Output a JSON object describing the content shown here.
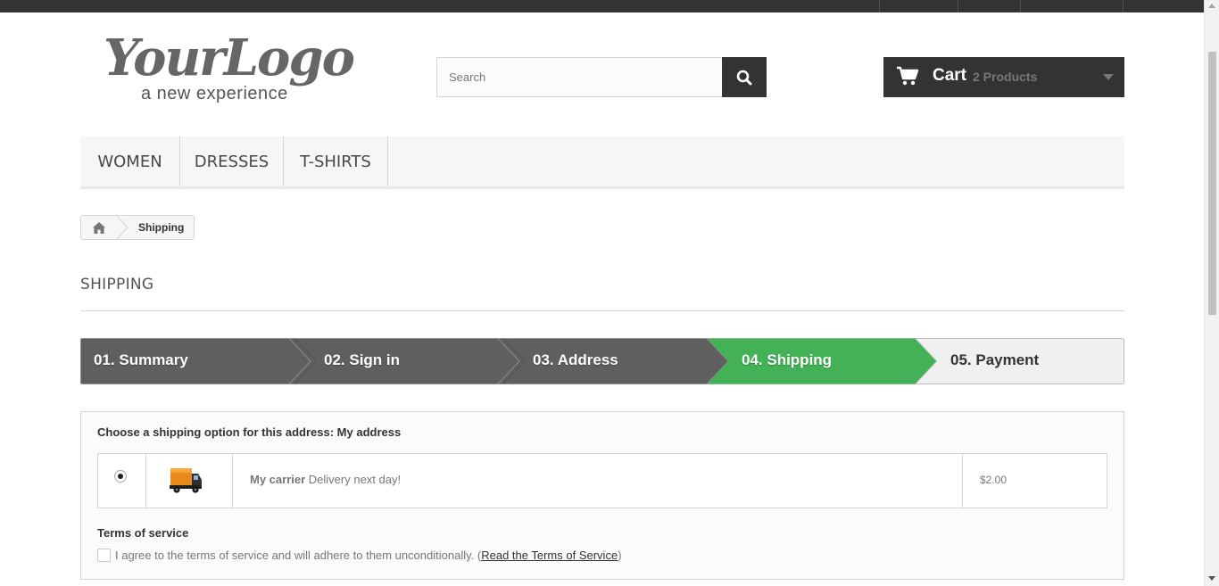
{
  "header": {
    "logo": {
      "main": "YourLogo",
      "tagline": "a new experience"
    },
    "search": {
      "placeholder": "Search"
    },
    "cart": {
      "title": "Cart",
      "quantity": "2 Products"
    }
  },
  "menu": {
    "items": [
      {
        "label": "Women"
      },
      {
        "label": "Dresses"
      },
      {
        "label": "T-shirts"
      }
    ]
  },
  "breadcrumb": {
    "current": "Shipping"
  },
  "page": {
    "heading": "SHIPPING"
  },
  "steps": [
    {
      "label": "01. Summary",
      "state": "done"
    },
    {
      "label": "02. Sign in",
      "state": "done"
    },
    {
      "label": "03. Address",
      "state": "done"
    },
    {
      "label": "04. Shipping",
      "state": "current"
    },
    {
      "label": "05. Payment",
      "state": "todo"
    }
  ],
  "colors": {
    "done": "#5f5f5f",
    "current": "#43b155",
    "todo": "#f0f0f0",
    "dark": "#333333"
  },
  "shipping": {
    "choose_label": "Choose a shipping option for this address: My address",
    "option": {
      "selected": true,
      "carrier_name": "My carrier",
      "delay": "Delivery next day!",
      "price": "$2.00",
      "icon": "delivery-truck-icon"
    },
    "terms": {
      "title": "Terms of service",
      "checked": false,
      "text": "I agree to the terms of service and will adhere to them unconditionally.",
      "link_open": "(",
      "link": "Read the Terms of Service",
      "link_close": ")"
    }
  }
}
